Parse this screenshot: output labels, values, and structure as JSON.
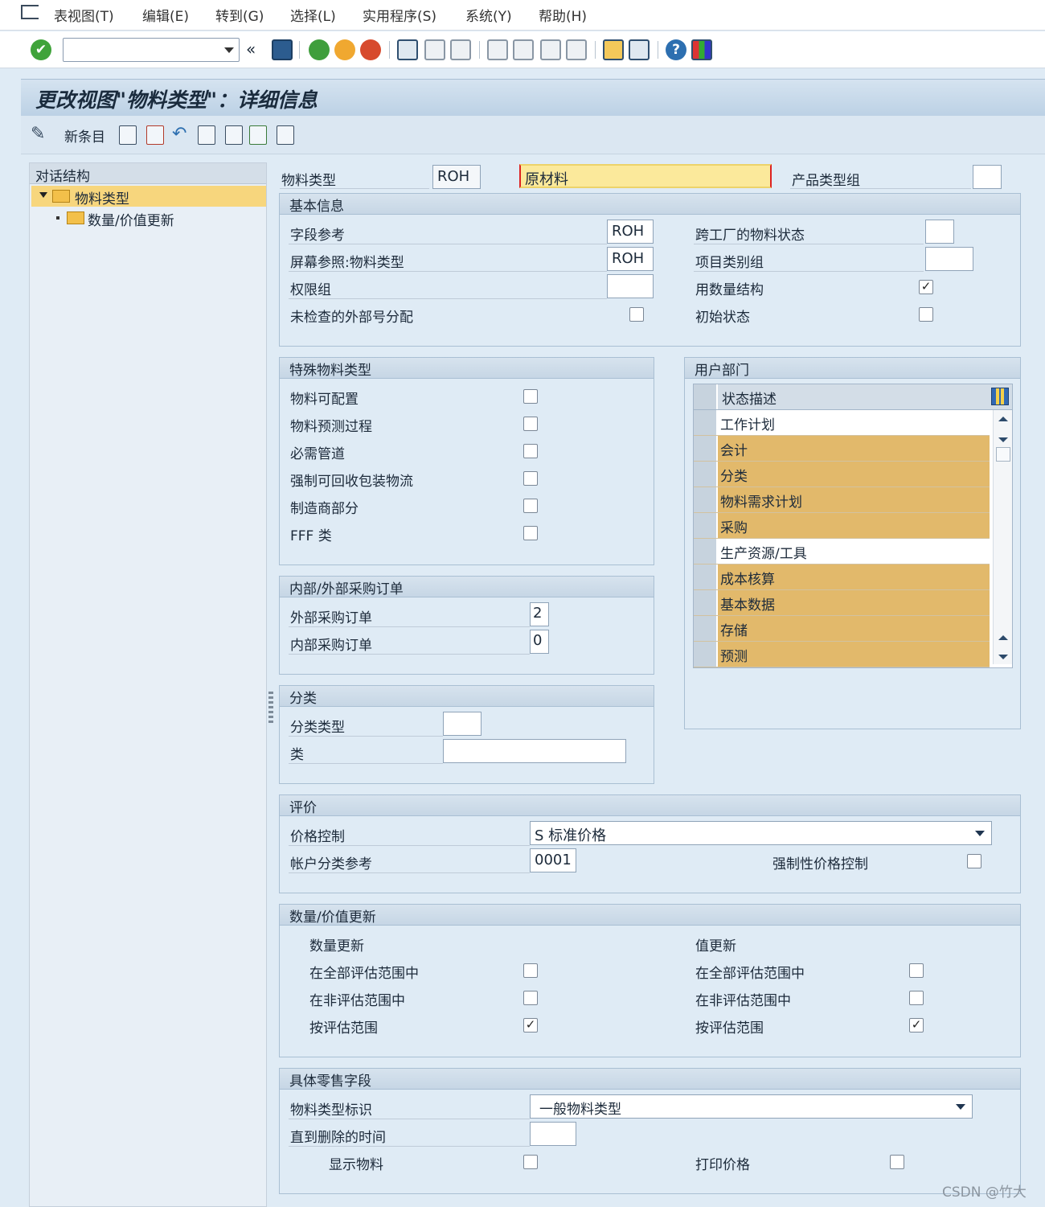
{
  "menubar": {
    "items": [
      "表视图(T)",
      "编辑(E)",
      "转到(G)",
      "选择(L)",
      "实用程序(S)",
      "系统(Y)",
      "帮助(H)"
    ]
  },
  "title": "更改视图\"物料类型\"：详细信息",
  "app_toolbar": {
    "new_entry": "新条目"
  },
  "tree": {
    "header": "对话结构",
    "nodes": [
      "物料类型",
      "数量/价值更新"
    ]
  },
  "header_fields": {
    "material_type_label": "物料类型",
    "material_type_code": "ROH",
    "material_type_desc": "原材料",
    "product_group_label": "产品类型组",
    "product_group_value": ""
  },
  "basic_info": {
    "title": "基本信息",
    "field_reference_label": "字段参考",
    "field_reference_value": "ROH",
    "screen_ref_label": "屏幕参照:物料类型",
    "screen_ref_value": "ROH",
    "auth_group_label": "权限组",
    "auth_group_value": "",
    "unchecked_ext_label": "未检查的外部号分配",
    "cross_plant_label": "跨工厂的物料状态",
    "cross_plant_value": "",
    "item_cat_label": "项目类别组",
    "item_cat_value": "",
    "qty_structure_label": "用数量结构",
    "initial_status_label": "初始状态",
    "qty_structure_checked": "✓",
    "initial_status_checked": ""
  },
  "special": {
    "title": "特殊物料类型",
    "items": [
      "物料可配置",
      "物料预测过程",
      "必需管道",
      "强制可回收包装物流",
      "制造商部分",
      "FFF 类"
    ]
  },
  "purchase": {
    "title": "内部/外部采购订单",
    "external_label": "外部采购订单",
    "external_value": "2",
    "internal_label": "内部采购订单",
    "internal_value": "0"
  },
  "classification": {
    "title": "分类",
    "class_type_label": "分类类型",
    "class_type_value": "",
    "class_label": "类",
    "class_value": ""
  },
  "user_departments": {
    "title": "用户部门",
    "column_header": "状态描述",
    "rows": [
      {
        "text": "工作计划",
        "selected": false
      },
      {
        "text": "会计",
        "selected": true
      },
      {
        "text": "分类",
        "selected": true
      },
      {
        "text": "物料需求计划",
        "selected": true
      },
      {
        "text": "采购",
        "selected": true
      },
      {
        "text": "生产资源/工具",
        "selected": false
      },
      {
        "text": "成本核算",
        "selected": true
      },
      {
        "text": "基本数据",
        "selected": true
      },
      {
        "text": "存储",
        "selected": true
      },
      {
        "text": "预测",
        "selected": true
      }
    ],
    "selected_color": "#e2b96b"
  },
  "valuation": {
    "title": "评价",
    "price_control_label": "价格控制",
    "price_control_value": "S 标准价格",
    "acct_cat_label": "帐户分类参考",
    "acct_cat_value": "0001",
    "forced_price_label": "强制性价格控制"
  },
  "qty_value": {
    "title": "数量/价值更新",
    "qty_header": "数量更新",
    "value_header": "值更新",
    "rows": [
      "在全部评估范围中",
      "在非评估范围中",
      "按评估范围"
    ],
    "qty_checked": [
      "",
      "",
      "✓"
    ],
    "value_checked": [
      "",
      "",
      "✓"
    ]
  },
  "retail": {
    "title": "具体零售字段",
    "mat_type_id_label": "物料类型标识",
    "mat_type_id_value": "一般物料类型",
    "until_delete_label": "直到删除的时间",
    "until_delete_value": "",
    "display_material_label": "显示物料",
    "print_price_label": "打印价格"
  },
  "watermark": "CSDN @竹大"
}
